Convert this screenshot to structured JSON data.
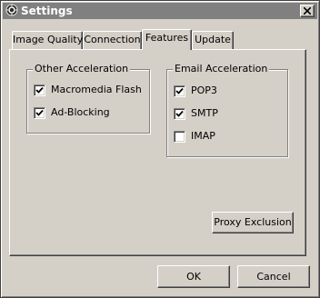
{
  "window": {
    "title": "Settings",
    "close_symbol": "×"
  },
  "tabs": [
    {
      "label": "Image Quality",
      "active": false
    },
    {
      "label": "Connection",
      "active": false
    },
    {
      "label": "Features",
      "active": true
    },
    {
      "label": "Update",
      "active": false
    }
  ],
  "other_acceleration": {
    "label": "Other Acceleration",
    "options": [
      {
        "label": "Macromedia Flash",
        "checked": true
      },
      {
        "label": "Ad-Blocking",
        "checked": true
      }
    ]
  },
  "email_acceleration": {
    "label": "Email Acceleration",
    "options": [
      {
        "label": "POP3",
        "checked": true
      },
      {
        "label": "SMTP",
        "checked": true
      },
      {
        "label": "IMAP",
        "checked": false
      }
    ]
  },
  "buttons": {
    "proxy_exclusion": "Proxy Exclusion",
    "ok": "OK",
    "cancel": "Cancel"
  },
  "colors": {
    "face": "#d4d0c8",
    "titlebar_inactive": "#808080"
  },
  "icons": {
    "app": "settings-gear-icon",
    "close": "close-icon",
    "check": "checkmark-icon"
  }
}
